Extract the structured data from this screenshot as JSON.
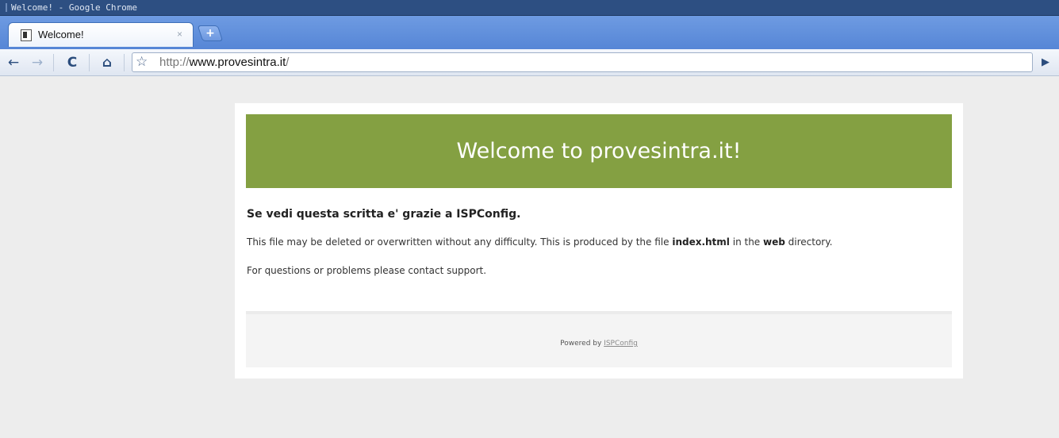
{
  "window": {
    "title": "Welcome! - Google Chrome"
  },
  "tabs": [
    {
      "label": "Welcome!",
      "close": "×"
    }
  ],
  "toolbar": {
    "new_tab": "+",
    "back": "←",
    "forward": "→",
    "reload": "C",
    "home": "⌂",
    "bookmark": "☆",
    "go": "▶"
  },
  "omnibox": {
    "scheme": "http://",
    "host": "www.provesintra.it",
    "path": "/"
  },
  "page": {
    "banner": "Welcome to provesintra.it!",
    "subheading": "Se vedi questa scritta e' grazie a ISPConfig.",
    "para1_a": "This file may be deleted or overwritten without any difficulty. This is produced by the file ",
    "para1_file": "index.html",
    "para1_b": " in the ",
    "para1_dir": "web",
    "para1_c": " directory.",
    "para2": "For questions or problems please contact support.",
    "footer_text": "Powered by ",
    "footer_link": "ISPConfig"
  },
  "colors": {
    "banner": "#84a042",
    "tabstrip": "#5686d6",
    "titlebar": "#2d4f82",
    "background": "#ededed"
  }
}
